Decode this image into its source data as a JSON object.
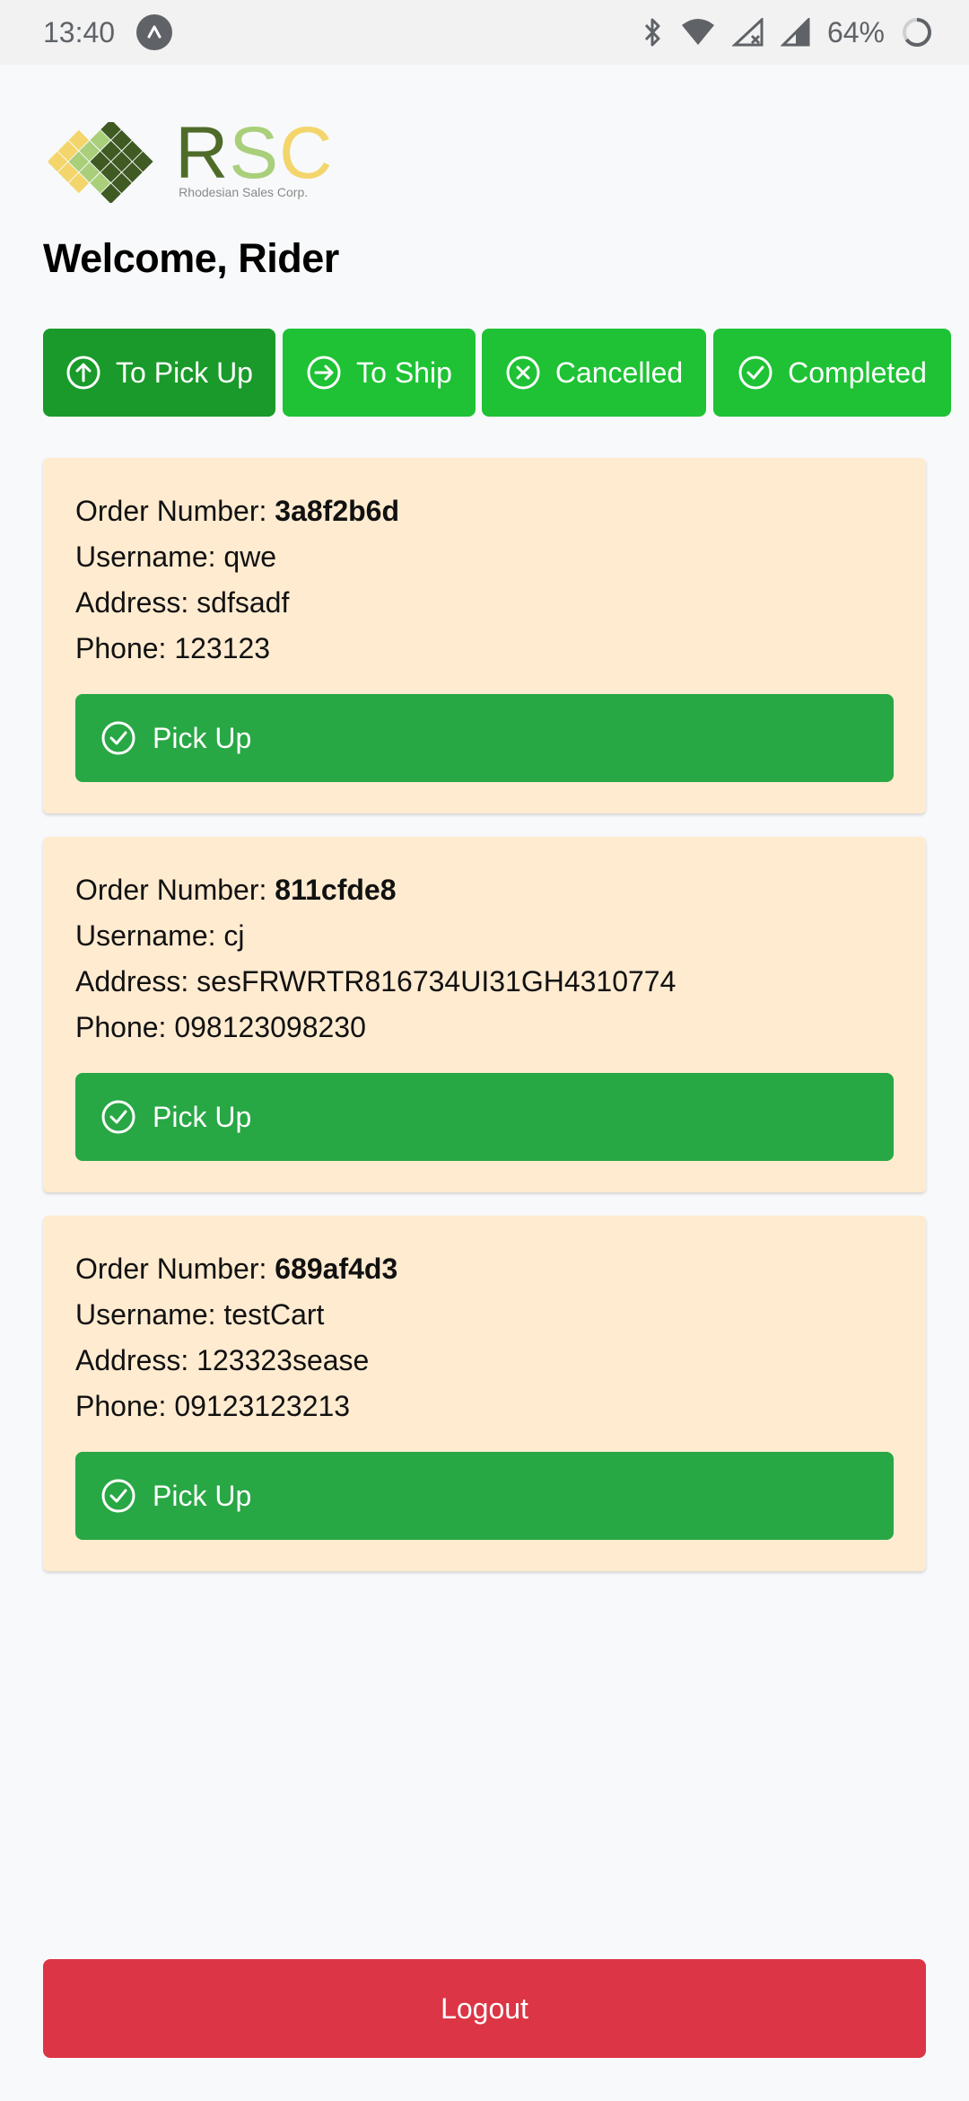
{
  "status_bar": {
    "time": "13:40",
    "battery": "64%",
    "icons": [
      "app-notification-icon",
      "bluetooth-icon",
      "wifi-icon",
      "signal-off-icon",
      "signal-icon",
      "battery-icon"
    ]
  },
  "logo": {
    "letters": [
      "R",
      "S",
      "C"
    ],
    "subtitle": "Rhodesian Sales Corp."
  },
  "header": {
    "welcome": "Welcome, Rider"
  },
  "tabs": [
    {
      "label": "To Pick Up",
      "icon": "arrow-up-circle-icon",
      "active": true
    },
    {
      "label": "To Ship",
      "icon": "arrow-right-circle-icon",
      "active": false
    },
    {
      "label": "Cancelled",
      "icon": "x-circle-icon",
      "active": false
    },
    {
      "label": "Completed",
      "icon": "check-circle-icon",
      "active": false
    }
  ],
  "labels": {
    "order_number": "Order Number: ",
    "username": "Username: ",
    "address": "Address: ",
    "phone": "Phone: "
  },
  "orders": [
    {
      "order_number": "3a8f2b6d",
      "username": "qwe",
      "address": "sdfsadf",
      "phone": "123123",
      "action": "Pick Up"
    },
    {
      "order_number": "811cfde8",
      "username": "cj",
      "address": "sesFRWRTR816734UI31GH4310774",
      "phone": "098123098230",
      "action": "Pick Up"
    },
    {
      "order_number": "689af4d3",
      "username": "testCart",
      "address": "123323sease",
      "phone": "09123123213",
      "action": "Pick Up"
    }
  ],
  "footer": {
    "logout_label": "Logout"
  },
  "colors": {
    "tab_green": "#1ec234",
    "tab_active_green": "#1a9a2a",
    "card_bg": "#ffebd0",
    "pickup_green": "#28a745",
    "logout_red": "#dc3545"
  }
}
